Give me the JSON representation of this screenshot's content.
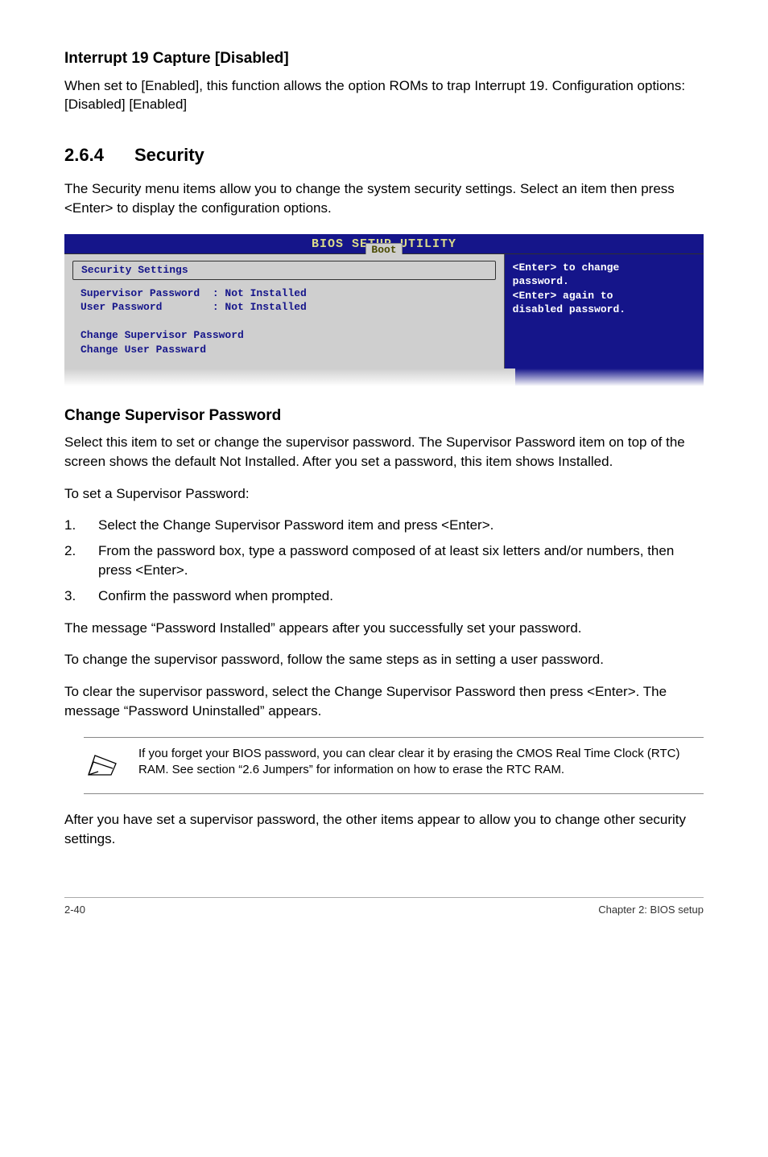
{
  "headings": {
    "interrupt19": "Interrupt 19 Capture [Disabled]",
    "sec_num": "2.6.4",
    "sec_title": "Security",
    "change_sup": "Change Supervisor Password"
  },
  "paragraphs": {
    "interrupt19_body": "When set to [Enabled], this function allows the option ROMs to trap Interrupt 19. Configuration options: [Disabled] [Enabled]",
    "security_intro": "The Security menu items allow you to change the system security settings. Select an item then press <Enter> to display the configuration options.",
    "change_sup_p1": "Select this item to set or change the supervisor password. The Supervisor Password item on top of the screen shows the default Not Installed. After you set a password, this item shows Installed.",
    "to_set": "To set a Supervisor Password:",
    "msg_installed": "The message “Password Installed” appears after you successfully set your password.",
    "to_change": "To change the supervisor password, follow the same steps as in setting a user password.",
    "to_clear": "To clear the supervisor password, select the Change Supervisor Password then press <Enter>. The message “Password Uninstalled” appears.",
    "after_set": "After you have set a supervisor password, the other items appear to allow you to change other security settings."
  },
  "steps": [
    {
      "n": "1.",
      "t": "Select the Change Supervisor Password item and press <Enter>."
    },
    {
      "n": "2.",
      "t": "From the password box, type a password composed of at least six letters and/or numbers, then press <Enter>."
    },
    {
      "n": "3.",
      "t": "Confirm the password when prompted."
    }
  ],
  "note": "If you forget your BIOS password, you can clear clear it by erasing the CMOS Real Time Clock (RTC) RAM. See section “2.6  Jumpers” for information on how to erase the RTC RAM.",
  "bios": {
    "title": "BIOS SETUP UTILITY",
    "tab": "Boot",
    "security_settings": "Security Settings",
    "sup_line": "Supervisor Password  : Not Installed",
    "user_line": "User Password        : Not Installed",
    "change_sup": "Change Supervisor Password",
    "change_user": "Change User Passward",
    "help1": "<Enter> to change",
    "help2": "password.",
    "help3": "<Enter> again to",
    "help4": "disabled password."
  },
  "footer": {
    "left": "2-40",
    "right": "Chapter 2: BIOS setup"
  }
}
